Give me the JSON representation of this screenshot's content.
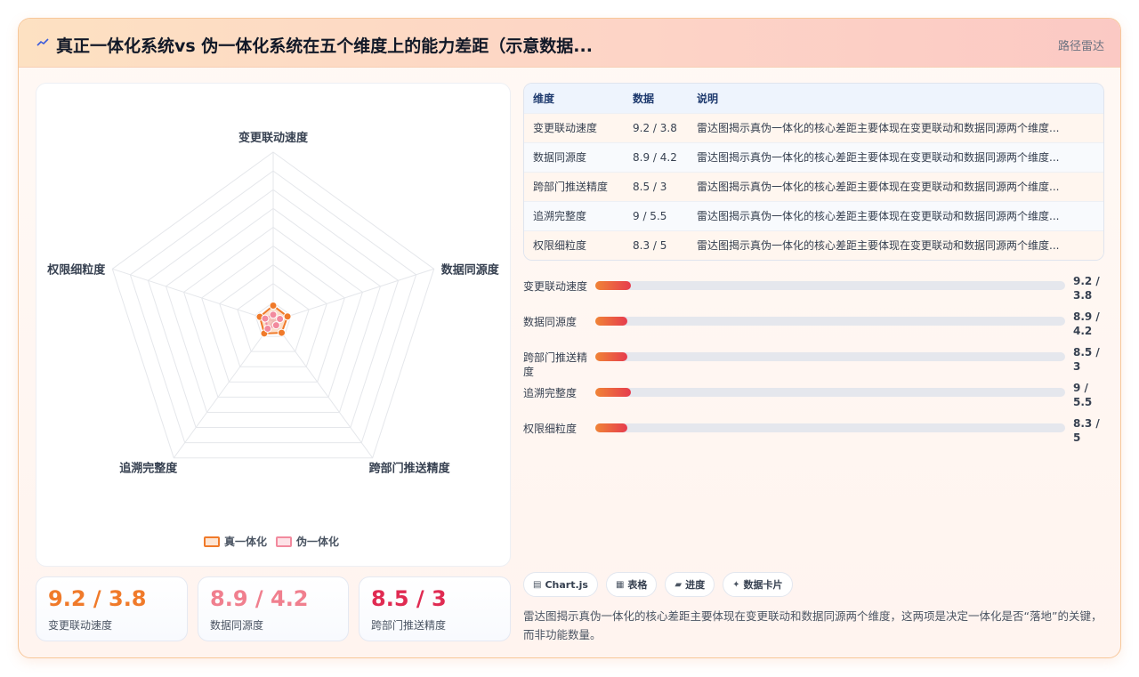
{
  "header": {
    "title": "真正一体化系统vs 伪一体化系统在五个维度上的能力差距（示意数据...",
    "link": "路径雷达"
  },
  "colors": {
    "series_true": "#f07a2a",
    "series_fake": "#f28a9e",
    "accent_red": "#e02b52"
  },
  "chart_data": {
    "type": "radar",
    "axes": [
      "变更联动速度",
      "数据同源度",
      "跨部门推送精度",
      "追溯完整度",
      "权限细粒度"
    ],
    "series": [
      {
        "name": "真一体化",
        "values": [
          9.2,
          8.9,
          8.5,
          9,
          8.3
        ]
      },
      {
        "name": "伪一体化",
        "values": [
          3.8,
          4.2,
          3,
          5.5,
          5
        ]
      }
    ],
    "rmax": 100,
    "grid_levels": 9,
    "legend": "bottom"
  },
  "legend": {
    "true": "真一体化",
    "fake": "伪一体化"
  },
  "stats": [
    {
      "value": "9.2 / 3.8",
      "label": "变更联动速度"
    },
    {
      "value": "8.9 / 4.2",
      "label": "数据同源度"
    },
    {
      "value": "8.5 / 3",
      "label": "跨部门推送精度"
    }
  ],
  "table": {
    "headers": [
      "维度",
      "数据",
      "说明"
    ],
    "rows": [
      {
        "dim": "变更联动速度",
        "data": "9.2 / 3.8",
        "note": "雷达图揭示真伪一体化的核心差距主要体现在变更联动和数据同源两个维度..."
      },
      {
        "dim": "数据同源度",
        "data": "8.9 / 4.2",
        "note": "雷达图揭示真伪一体化的核心差距主要体现在变更联动和数据同源两个维度..."
      },
      {
        "dim": "跨部门推送精度",
        "data": "8.5 / 3",
        "note": "雷达图揭示真伪一体化的核心差距主要体现在变更联动和数据同源两个维度..."
      },
      {
        "dim": "追溯完整度",
        "data": "9 / 5.5",
        "note": "雷达图揭示真伪一体化的核心差距主要体现在变更联动和数据同源两个维度..."
      },
      {
        "dim": "权限细粒度",
        "data": "8.3 / 5",
        "note": "雷达图揭示真伪一体化的核心差距主要体现在变更联动和数据同源两个维度..."
      }
    ]
  },
  "progress": [
    {
      "label": "变更联动速度",
      "value": "9.2 / 3.8",
      "fraction": 0.075
    },
    {
      "label": "数据同源度",
      "value": "8.9 / 4.2",
      "fraction": 0.068
    },
    {
      "label": "跨部门推送精度",
      "value": "8.5 / 3",
      "fraction": 0.068
    },
    {
      "label": "追溯完整度",
      "value": "9 / 5.5",
      "fraction": 0.075
    },
    {
      "label": "权限细粒度",
      "value": "8.3 / 5",
      "fraction": 0.068
    }
  ],
  "chips": [
    {
      "icon": "▤",
      "label": "Chart.js"
    },
    {
      "icon": "▦",
      "label": "表格"
    },
    {
      "icon": "▰",
      "label": "进度"
    },
    {
      "icon": "✦",
      "label": "数据卡片"
    }
  ],
  "summary": "雷达图揭示真伪一体化的核心差距主要体现在变更联动和数据同源两个维度，这两项是决定一体化是否“落地”的关键，而非功能数量。"
}
